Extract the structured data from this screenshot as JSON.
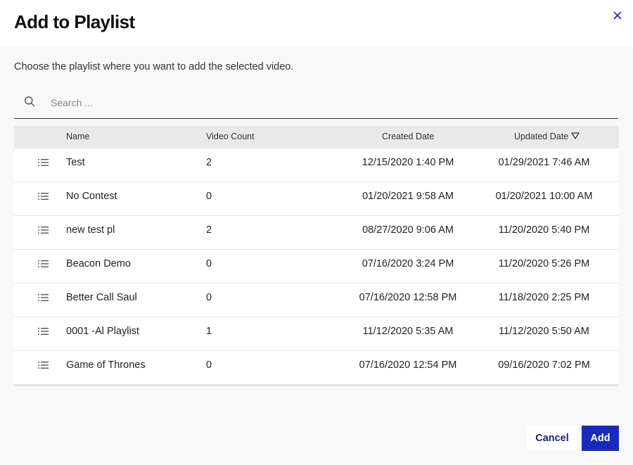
{
  "dialog": {
    "title": "Add to Playlist",
    "subtitle": "Choose the playlist where you want to add the selected video."
  },
  "search": {
    "placeholder": "Search ...",
    "value": ""
  },
  "table": {
    "columns": {
      "name": "Name",
      "video_count": "Video Count",
      "created_date": "Created Date",
      "updated_date": "Updated Date"
    },
    "sort": {
      "column": "updated_date",
      "direction": "descending"
    },
    "rows": [
      {
        "name": "Test",
        "video_count": "2",
        "created": "12/15/2020 1:40 PM",
        "updated": "01/29/2021 7:46 AM"
      },
      {
        "name": "No Contest",
        "video_count": "0",
        "created": "01/20/2021 9:58 AM",
        "updated": "01/20/2021 10:00 AM"
      },
      {
        "name": "new test pl",
        "video_count": "2",
        "created": "08/27/2020 9:06 AM",
        "updated": "11/20/2020 5:40 PM"
      },
      {
        "name": "Beacon Demo",
        "video_count": "0",
        "created": "07/16/2020 3:24 PM",
        "updated": "11/20/2020 5:26 PM"
      },
      {
        "name": "Better Call Saul",
        "video_count": "0",
        "created": "07/16/2020 12:58 PM",
        "updated": "11/18/2020 2:25 PM"
      },
      {
        "name": "0001 -Al Playlist",
        "video_count": "1",
        "created": "11/12/2020 5:35 AM",
        "updated": "11/12/2020 5:50 AM"
      },
      {
        "name": "Game of Thrones",
        "video_count": "0",
        "created": "07/16/2020 12:54 PM",
        "updated": "09/16/2020 7:02 PM"
      }
    ]
  },
  "footer": {
    "cancel_label": "Cancel",
    "add_label": "Add"
  },
  "colors": {
    "primary": "#1a2ab8",
    "cancel_text": "#1a237e",
    "close_icon": "#1a2ab8",
    "header_row": "#e9e9e9"
  },
  "icons": {
    "close": "close-icon",
    "search": "search-icon",
    "sort": "sort-descending-icon",
    "row": "playlist-icon"
  }
}
